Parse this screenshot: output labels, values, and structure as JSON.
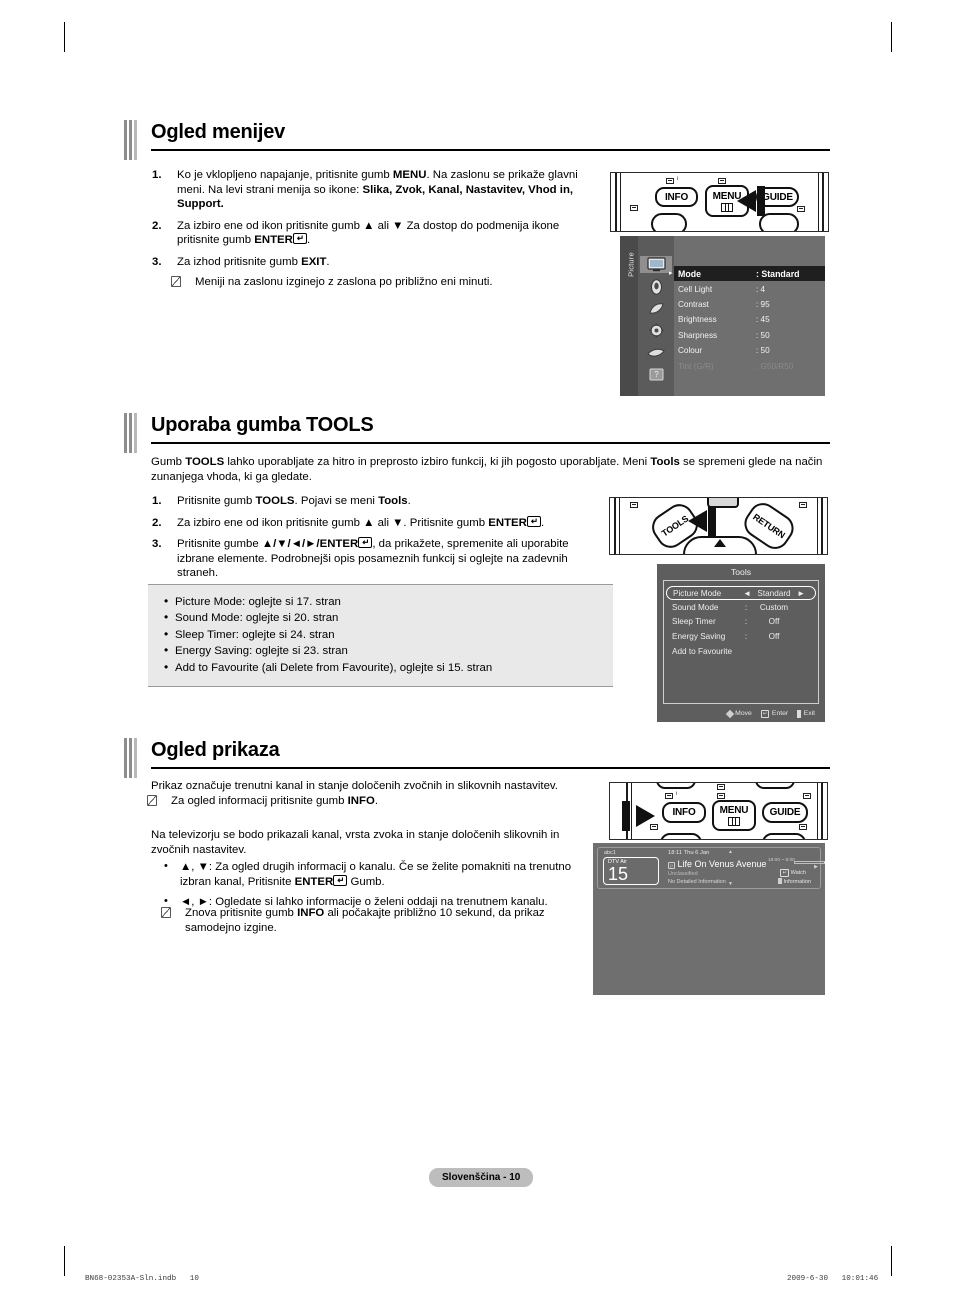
{
  "sections": {
    "menus": {
      "title": "Ogled menijev",
      "steps": [
        {
          "num": "1.",
          "html": "Ko je vklopljeno napajanje, pritisnite gumb <b>MENU</b>. Na zaslonu se prikaže glavni meni. Na levi strani menija so ikone: <b>Slika, Zvok, Kanal, Nastavitev, Vhod in, Support.</b>"
        },
        {
          "num": "2.",
          "html": "Za izbiro ene od ikon pritisnite gumb ▲ ali ▼ Za dostop do podmenija ikone pritisnite gumb <b>ENTER</b><span class=\"keyglyph\">↵</span>."
        },
        {
          "num": "3.",
          "html": "Za izhod pritisnite gumb <b>EXIT</b>."
        }
      ],
      "note": "Meniji na zaslonu izginejo z zaslona po približno eni minuti."
    },
    "tools": {
      "title": "Uporaba gumba TOOLS",
      "intro_html": "Gumb <b>TOOLS</b> lahko uporabljate za hitro in preprosto izbiro funkcij, ki jih pogosto uporabljate. Meni <b>Tools</b> se spremeni glede na način zunanjega vhoda, ki ga gledate.",
      "steps": [
        {
          "num": "1.",
          "html": "Pritisnite gumb <b>TOOLS</b>. Pojavi se meni <b>Tools</b>."
        },
        {
          "num": "2.",
          "html": "Za izbiro ene od ikon pritisnite gumb ▲ ali ▼. Pritisnite gumb <b>ENTER</b><span class=\"keyglyph\">↵</span>."
        },
        {
          "num": "3.",
          "html": "Pritisnite gumbe <b>▲/▼/◄/►/ENTER</b><span class=\"keyglyph\">↵</span>, da prikažete, spremenite ali uporabite izbrane elemente. Podrobnejši opis posameznih funkcij si oglejte na zadevnih straneh."
        }
      ],
      "refs": [
        "Picture Mode: oglejte si 17. stran",
        "Sound Mode: oglejte si 20. stran",
        "Sleep Timer: oglejte si 24. stran",
        "Energy Saving: oglejte si 23. stran",
        "Add to Favourite (ali Delete from Favourite), oglejte si 15. stran"
      ]
    },
    "display": {
      "title": "Ogled prikaza",
      "intro": "Prikaz označuje trenutni kanal in stanje določenih zvočnih in slikovnih nastavitev.",
      "intro_note_html": "Za ogled informacij pritisnite gumb <b>INFO</b>.",
      "para2": "Na televizorju se bodo prikazali kanal, vrsta zvoka in stanje določenih slikovnih in zvočnih nastavitev.",
      "bullets": [
        "<b>▲</b>, <b>▼</b>: Za ogled drugih informacij o kanalu. Če se želite pomakniti na trenutno izbran kanal, Pritisnite <b>ENTER</b><span class=\"keyglyph\">↵</span> Gumb.",
        "<b>◄</b>, <b>►</b>: Ogledate si lahko informacije o želeni oddaji na trenutnem kanalu."
      ],
      "note": "Znova pritisnite gumb <b>INFO</b> ali počakajte približno 10 sekund, da prikaz samodejno izgine."
    }
  },
  "remotes": {
    "remote1": {
      "buttons": [
        "INFO",
        "MENU",
        "GUIDE"
      ],
      "pointer_target": "MENU"
    },
    "remote2": {
      "buttons": [
        "TOOLS",
        "RETURN"
      ],
      "pointer_target": "TOOLS"
    },
    "remote3": {
      "buttons": [
        "INFO",
        "MENU",
        "GUIDE"
      ],
      "pointer_target": "INFO"
    }
  },
  "picture_menu": {
    "sidebar_label": "Picture",
    "rows": [
      {
        "label": "Mode",
        "value": ": Standard",
        "state": "highlighted"
      },
      {
        "label": "Cell Light",
        "value": ": 4",
        "state": "normal"
      },
      {
        "label": "Contrast",
        "value": ": 95",
        "state": "normal"
      },
      {
        "label": "Brightness",
        "value": ": 45",
        "state": "normal"
      },
      {
        "label": "Sharpness",
        "value": ": 50",
        "state": "normal"
      },
      {
        "label": "Colour",
        "value": ": 50",
        "state": "normal"
      },
      {
        "label": "Tint (G/R)",
        "value": ": G50/R50",
        "state": "dimmed"
      }
    ],
    "icons": [
      "picture-icon",
      "sound-icon",
      "channel-icon",
      "setup-icon",
      "input-icon",
      "support-icon"
    ]
  },
  "tools_menu": {
    "title": "Tools",
    "rows": [
      {
        "label": "Picture Mode",
        "sep": "◄",
        "value": "Standard",
        "sep_right": "►",
        "selected": true
      },
      {
        "label": "Sound Mode",
        "sep": ":",
        "value": "Custom",
        "sep_right": "",
        "selected": false
      },
      {
        "label": "Sleep Timer",
        "sep": ":",
        "value": "Off",
        "sep_right": "",
        "selected": false
      },
      {
        "label": "Energy Saving",
        "sep": ":",
        "value": "Off",
        "sep_right": "",
        "selected": false
      },
      {
        "label": "Add to Favourite",
        "sep": "",
        "value": "",
        "sep_right": "",
        "selected": false
      }
    ],
    "footer": {
      "move": "Move",
      "enter": "Enter",
      "exit": "Exit"
    }
  },
  "info_banner": {
    "source_label": "abc1",
    "mode": "DTV Air",
    "channel": "15",
    "datetime": "18:11 Thu 6 Jan",
    "programme": "Life On Venus Avenue",
    "rating": "Unclassified",
    "detail": "No Detailed Information",
    "time_range": "18:00 ~ 6:00",
    "watch": "Watch",
    "information": "Information"
  },
  "footer": {
    "page_badge": "Slovenščina - 10",
    "print_left": "BN68-02353A-Sln.indb   10",
    "print_right": "2009-6-30   10:01:46"
  }
}
